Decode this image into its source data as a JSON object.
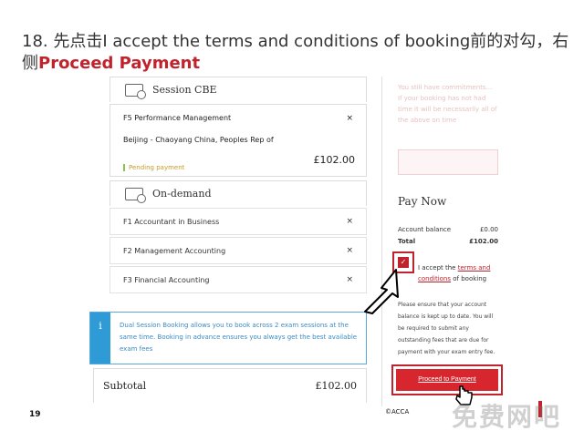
{
  "slide": {
    "title_prefix": "18. 先点击I accept the terms and conditions of booking前的对勾，右侧",
    "title_highlight": "Proceed Payment",
    "page_number": "19",
    "copyright": "©ACCA",
    "watermark": "免费网吧"
  },
  "basket": {
    "session_cbe": {
      "heading": "Session CBE",
      "icon": "computer-icon",
      "exam": "F5 Performance Management",
      "location": "Beijing - Chaoyang   China, Peoples Rep of",
      "status": "Pending payment",
      "price": "£102.00",
      "remove": "×"
    },
    "on_demand": {
      "heading": "On-demand",
      "icon": "computer-icon",
      "items": [
        {
          "label": "F1 Accountant in Business",
          "remove": "×"
        },
        {
          "label": "F2 Management Accounting",
          "remove": "×"
        },
        {
          "label": "F3 Financial Accounting",
          "remove": "×"
        }
      ]
    },
    "info": {
      "icon_letter": "i",
      "text": "Dual Session Booking allows you to book across 2 exam sessions at the same time. Booking in advance ensures you always get the best available exam fees"
    },
    "subtotal": {
      "label": "Subtotal",
      "value": "£102.00"
    }
  },
  "sidebar": {
    "faded_text": "You still have commitments… If your booking has not had time it will be necessarily all of the above on time",
    "pay_now": {
      "heading": "Pay Now",
      "account_balance_label": "Account balance",
      "account_balance_value": "£0.00",
      "total_label": "Total",
      "total_value": "£102.00"
    },
    "terms": {
      "checked": true,
      "prefix": "I accept the ",
      "link1": "terms and",
      "link2": "conditions",
      "suffix": " of booking"
    },
    "note": "Please ensure that your account balance is kept up to date. You will be required to submit any outstanding fees that are due for payment with your exam entry fee.",
    "proceed_label": "Proceed to Payment"
  },
  "colors": {
    "accent_red": "#c0232b",
    "button_red": "#d8262e",
    "info_blue": "#2e9bd6",
    "pending_green": "#8bc34a"
  }
}
